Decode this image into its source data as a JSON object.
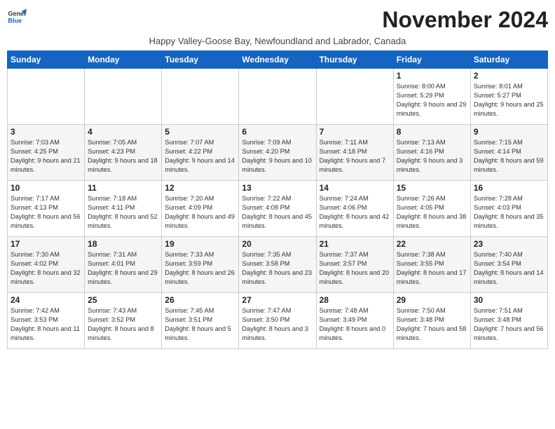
{
  "logo": {
    "line1": "General",
    "line2": "Blue"
  },
  "title": "November 2024",
  "subtitle": "Happy Valley-Goose Bay, Newfoundland and Labrador, Canada",
  "days_of_week": [
    "Sunday",
    "Monday",
    "Tuesday",
    "Wednesday",
    "Thursday",
    "Friday",
    "Saturday"
  ],
  "weeks": [
    [
      {
        "day": "",
        "info": ""
      },
      {
        "day": "",
        "info": ""
      },
      {
        "day": "",
        "info": ""
      },
      {
        "day": "",
        "info": ""
      },
      {
        "day": "",
        "info": ""
      },
      {
        "day": "1",
        "info": "Sunrise: 8:00 AM\nSunset: 5:29 PM\nDaylight: 9 hours and 29 minutes."
      },
      {
        "day": "2",
        "info": "Sunrise: 8:01 AM\nSunset: 5:27 PM\nDaylight: 9 hours and 25 minutes."
      }
    ],
    [
      {
        "day": "3",
        "info": "Sunrise: 7:03 AM\nSunset: 4:25 PM\nDaylight: 9 hours and 21 minutes."
      },
      {
        "day": "4",
        "info": "Sunrise: 7:05 AM\nSunset: 4:23 PM\nDaylight: 9 hours and 18 minutes."
      },
      {
        "day": "5",
        "info": "Sunrise: 7:07 AM\nSunset: 4:22 PM\nDaylight: 9 hours and 14 minutes."
      },
      {
        "day": "6",
        "info": "Sunrise: 7:09 AM\nSunset: 4:20 PM\nDaylight: 9 hours and 10 minutes."
      },
      {
        "day": "7",
        "info": "Sunrise: 7:11 AM\nSunset: 4:18 PM\nDaylight: 9 hours and 7 minutes."
      },
      {
        "day": "8",
        "info": "Sunrise: 7:13 AM\nSunset: 4:16 PM\nDaylight: 9 hours and 3 minutes."
      },
      {
        "day": "9",
        "info": "Sunrise: 7:15 AM\nSunset: 4:14 PM\nDaylight: 8 hours and 59 minutes."
      }
    ],
    [
      {
        "day": "10",
        "info": "Sunrise: 7:17 AM\nSunset: 4:13 PM\nDaylight: 8 hours and 56 minutes."
      },
      {
        "day": "11",
        "info": "Sunrise: 7:18 AM\nSunset: 4:11 PM\nDaylight: 8 hours and 52 minutes."
      },
      {
        "day": "12",
        "info": "Sunrise: 7:20 AM\nSunset: 4:09 PM\nDaylight: 8 hours and 49 minutes."
      },
      {
        "day": "13",
        "info": "Sunrise: 7:22 AM\nSunset: 4:08 PM\nDaylight: 8 hours and 45 minutes."
      },
      {
        "day": "14",
        "info": "Sunrise: 7:24 AM\nSunset: 4:06 PM\nDaylight: 8 hours and 42 minutes."
      },
      {
        "day": "15",
        "info": "Sunrise: 7:26 AM\nSunset: 4:05 PM\nDaylight: 8 hours and 38 minutes."
      },
      {
        "day": "16",
        "info": "Sunrise: 7:28 AM\nSunset: 4:03 PM\nDaylight: 8 hours and 35 minutes."
      }
    ],
    [
      {
        "day": "17",
        "info": "Sunrise: 7:30 AM\nSunset: 4:02 PM\nDaylight: 8 hours and 32 minutes."
      },
      {
        "day": "18",
        "info": "Sunrise: 7:31 AM\nSunset: 4:01 PM\nDaylight: 8 hours and 29 minutes."
      },
      {
        "day": "19",
        "info": "Sunrise: 7:33 AM\nSunset: 3:59 PM\nDaylight: 8 hours and 26 minutes."
      },
      {
        "day": "20",
        "info": "Sunrise: 7:35 AM\nSunset: 3:58 PM\nDaylight: 8 hours and 23 minutes."
      },
      {
        "day": "21",
        "info": "Sunrise: 7:37 AM\nSunset: 3:57 PM\nDaylight: 8 hours and 20 minutes."
      },
      {
        "day": "22",
        "info": "Sunrise: 7:38 AM\nSunset: 3:55 PM\nDaylight: 8 hours and 17 minutes."
      },
      {
        "day": "23",
        "info": "Sunrise: 7:40 AM\nSunset: 3:54 PM\nDaylight: 8 hours and 14 minutes."
      }
    ],
    [
      {
        "day": "24",
        "info": "Sunrise: 7:42 AM\nSunset: 3:53 PM\nDaylight: 8 hours and 11 minutes."
      },
      {
        "day": "25",
        "info": "Sunrise: 7:43 AM\nSunset: 3:52 PM\nDaylight: 8 hours and 8 minutes."
      },
      {
        "day": "26",
        "info": "Sunrise: 7:45 AM\nSunset: 3:51 PM\nDaylight: 8 hours and 5 minutes."
      },
      {
        "day": "27",
        "info": "Sunrise: 7:47 AM\nSunset: 3:50 PM\nDaylight: 8 hours and 3 minutes."
      },
      {
        "day": "28",
        "info": "Sunrise: 7:48 AM\nSunset: 3:49 PM\nDaylight: 8 hours and 0 minutes."
      },
      {
        "day": "29",
        "info": "Sunrise: 7:50 AM\nSunset: 3:48 PM\nDaylight: 7 hours and 58 minutes."
      },
      {
        "day": "30",
        "info": "Sunrise: 7:51 AM\nSunset: 3:48 PM\nDaylight: 7 hours and 56 minutes."
      }
    ]
  ]
}
